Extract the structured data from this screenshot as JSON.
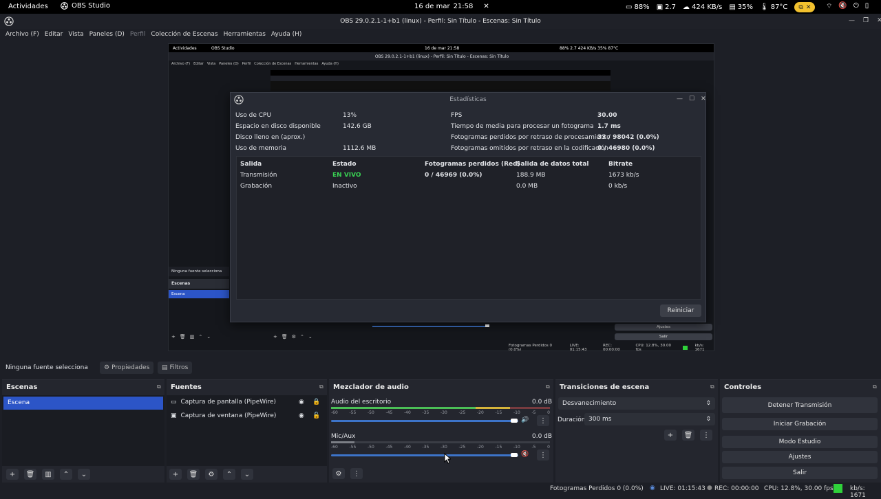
{
  "topbar": {
    "activities": "Actividades",
    "app_name": "OBS Studio",
    "date": "16 de mar",
    "time": "21:58",
    "battery": "88%",
    "load": "2.7",
    "network": "424 KB/s",
    "mem": "35%",
    "temp": "87°C"
  },
  "window": {
    "title": "OBS 29.0.2.1-1+b1 (linux) - Perfil: Sin Título - Escenas: Sin Título"
  },
  "menu": [
    "Archivo (F)",
    "Editar",
    "Vista",
    "Paneles (D)",
    "Perfil",
    "Colección de Escenas",
    "Herramientas",
    "Ayuda (H)"
  ],
  "preview_mini": {
    "activities": "Actividades",
    "app_name": "OBS Studio",
    "date": "16 de mar 21:58",
    "stats": "88%  2.7  424 KB/s  35%  87°C",
    "title": "OBS 29.0.2.1-1+b1 (linux) - Perfil: Sin Título - Escenas: Sin Título",
    "menu": [
      "Archivo (F)",
      "Editar",
      "Vista",
      "Paneles (D)",
      "Perfil",
      "Colección de Escenas",
      "Herramientas",
      "Ayuda (H)"
    ],
    "no_source": "Ninguna fuente selecciona",
    "scenes": "Escenas",
    "scene": "Escena",
    "ajustes": "Ajustes",
    "salir": "Salir",
    "status": "Fotogramas Perdidos 0 (0.0%)",
    "live": "LIVE: 01:15:43",
    "rec": "REC: 00:00:00",
    "cpu": "CPU: 12.8%, 30.00 fps",
    "kbs": "kb/s: 1671"
  },
  "stats_dialog": {
    "title": "Estadísticas",
    "left": [
      {
        "label": "Uso de CPU",
        "value": "13%"
      },
      {
        "label": "Espacio en disco disponible",
        "value": "142.6 GB"
      },
      {
        "label": "Disco lleno en (aprox.)",
        "value": ""
      },
      {
        "label": "Uso de memoria",
        "value": "1112.6 MB"
      }
    ],
    "right": [
      {
        "label": "FPS",
        "value": "30.00"
      },
      {
        "label": "Tiempo de media para procesar un fotograma",
        "value": "1.7 ms"
      },
      {
        "label": "Fotogramas perdidos por retraso de procesamiento",
        "value": "33 / 98042 (0.0%)"
      },
      {
        "label": "Fotogramas omitidos por retraso en la codificación",
        "value": "0 / 46980 (0.0%)"
      }
    ],
    "table": {
      "headers": [
        "Salida",
        "Estado",
        "Fotogramas perdidos (Red)",
        "Salida de datos total",
        "Bitrate"
      ],
      "rows": [
        [
          "Transmisión",
          "EN VIVO",
          "0 / 46969 (0.0%)",
          "188.9 MB",
          "1673 kb/s"
        ],
        [
          "Grabación",
          "Inactivo",
          "",
          "0.0 MB",
          "0 kb/s"
        ]
      ]
    },
    "reset_label": "Reiniciar"
  },
  "source_bar": {
    "no_source": "Ninguna fuente selecciona",
    "properties": "Propiedades",
    "filters": "Filtros"
  },
  "scenes": {
    "title": "Escenas",
    "items": [
      "Escena"
    ]
  },
  "sources": {
    "title": "Fuentes",
    "items": [
      "Captura de pantalla (PipeWire)",
      "Captura de ventana (PipeWire)"
    ]
  },
  "mixer": {
    "title": "Mezclador de audio",
    "channels": [
      {
        "name": "Audio del escritorio",
        "db": "0.0 dB",
        "level": 0.88
      },
      {
        "name": "Mic/Aux",
        "db": "0.0 dB",
        "level": 0.88
      }
    ],
    "ticks": [
      "-60",
      "-55",
      "-50",
      "-45",
      "-40",
      "-35",
      "-30",
      "-25",
      "-20",
      "-15",
      "-10",
      "-5",
      "0"
    ]
  },
  "transitions": {
    "title": "Transiciones de escena",
    "type": "Desvanecimiento",
    "duration_label": "Duración",
    "duration": "300 ms"
  },
  "controls": {
    "title": "Controles",
    "buttons": [
      "Detener Transmisión",
      "Iniciar Grabación",
      "Modo Estudio",
      "Ajustes",
      "Salir"
    ]
  },
  "statusbar": {
    "dropped": "Fotogramas Perdidos 0 (0.0%)",
    "live": "LIVE: 01:15:43",
    "rec": "REC: 00:00:00",
    "cpu": "CPU: 12.8%, 30.00 fps",
    "kbs": "kb/s: 1671"
  },
  "colors": {
    "accent": "#2c55c7",
    "live": "#39d353",
    "status_green": "#2fd13a"
  }
}
